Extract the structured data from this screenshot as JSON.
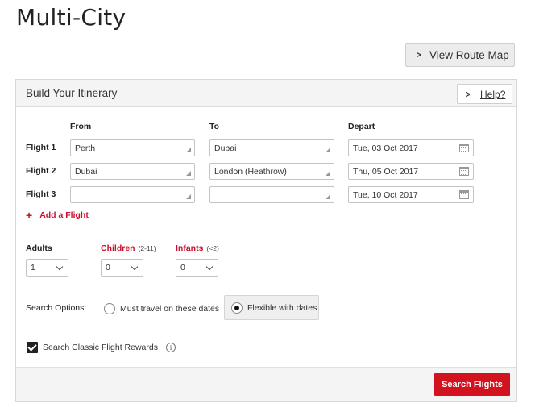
{
  "page": {
    "title": "Multi-City"
  },
  "route_map": {
    "label": "View Route Map"
  },
  "itinerary": {
    "title": "Build Your Itinerary",
    "help_label": "Help?",
    "columns": {
      "from": "From",
      "to": "To",
      "depart": "Depart"
    },
    "flights": [
      {
        "label": "Flight 1",
        "from": "Perth",
        "to": "Dubai",
        "depart": "Tue, 03 Oct 2017"
      },
      {
        "label": "Flight 2",
        "from": "Dubai",
        "to": "London (Heathrow)",
        "depart": "Thu, 05 Oct 2017"
      },
      {
        "label": "Flight 3",
        "from": "",
        "to": "",
        "depart": "Tue, 10 Oct 2017"
      }
    ],
    "add_flight": "Add a Flight"
  },
  "passengers": {
    "adults": {
      "label": "Adults",
      "value": "1"
    },
    "children": {
      "label": "Children",
      "note": "(2-11)",
      "value": "0"
    },
    "infants": {
      "label": "Infants",
      "note": "(<2)",
      "value": "0"
    }
  },
  "search_options": {
    "label": "Search Options:",
    "options": [
      {
        "label": "Must travel on these dates",
        "selected": false
      },
      {
        "label": "Flexible with dates",
        "selected": true
      }
    ]
  },
  "rewards": {
    "label": "Search Classic Flight Rewards",
    "checked": true
  },
  "actions": {
    "search_label": "Search Flights"
  },
  "colors": {
    "accent_red": "#d3121f",
    "link_red": "#c8102e"
  }
}
